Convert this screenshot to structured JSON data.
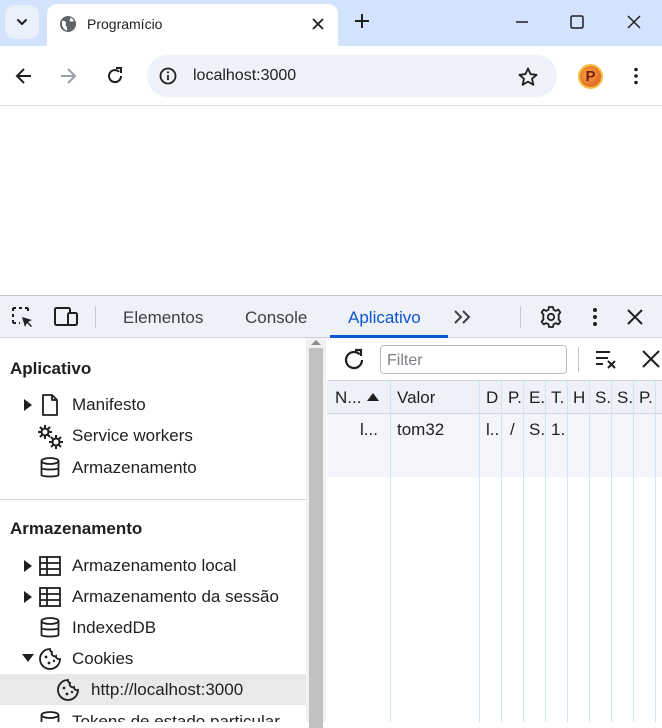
{
  "browser": {
    "tab_title": "Programício",
    "url": "localhost:3000",
    "profile_letter": "P"
  },
  "devtools": {
    "tabs": [
      "Elementos",
      "Console",
      "Aplicativo"
    ],
    "active_tab": "Aplicativo"
  },
  "sidebar": {
    "section_app": "Aplicativo",
    "app_items": [
      "Manifesto",
      "Service workers",
      "Armazenamento"
    ],
    "section_storage": "Armazenamento",
    "storage_items": [
      "Armazenamento local",
      "Armazenamento da sessão",
      "IndexedDB",
      "Cookies"
    ],
    "cookie_origin": "http://localhost:3000",
    "truncated_item": "Tokens de estado particular"
  },
  "cookies": {
    "filter_placeholder": "Filter",
    "headers": [
      "N...",
      "Valor",
      "D",
      "P.",
      "E.",
      "T.",
      "H",
      "S.",
      "S.",
      "P."
    ],
    "rows": [
      [
        "l...",
        "tom32",
        "l..",
        "/",
        "S.",
        "1.",
        "",
        "",
        "",
        ""
      ]
    ]
  }
}
